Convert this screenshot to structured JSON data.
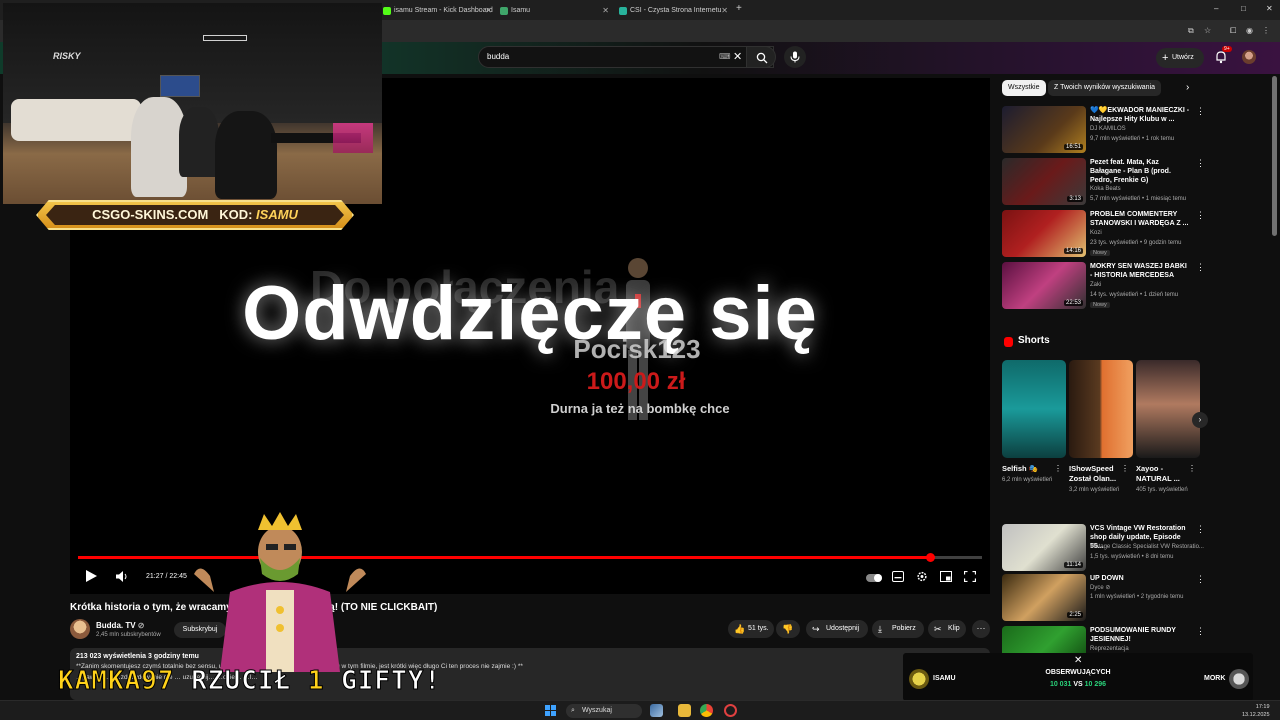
{
  "browser": {
    "tabs": [
      {
        "label": "isamu Stream - Kick Dashboard",
        "color": "#53fc18"
      },
      {
        "label": "Isamu",
        "color": "#3fa66a"
      },
      {
        "label": "CSI - Czysta Strona Internetu",
        "color": "#28b39c"
      }
    ],
    "new_tab": "+",
    "window_controls": [
      "–",
      "□",
      "✕"
    ]
  },
  "youtube": {
    "search": {
      "value": "budda"
    },
    "create_label": "Utwórz",
    "notif_count": "9+",
    "video": {
      "overlay_text": "Odwdzięczę się",
      "ghost_text": "Do połączenia",
      "donor_name": "Pocisk123",
      "donor_amount": "100,00 zł",
      "donor_message": "Durna ja też na bombkę chce",
      "time": "21:27 / 22:45",
      "progress": 0.943
    },
    "title": "Krótka historia o tym, że wracamy … pokaz Autoryzacją! (TO NIE CLICKBAIT)",
    "channel": {
      "name": "Budda. TV",
      "verified": "⊘",
      "subs": "2,45 mln subskrybentów",
      "subscribe": "Subskrybuj"
    },
    "actions": {
      "likes": "51 tys.",
      "share": "Udostępnij",
      "download": "Pobierz",
      "clip": "Klip",
      "more": "···"
    },
    "description": {
      "stats": "213 023 wyświetlenia  3 godziny temu",
      "line1": "**Zanim skomentujesz czymś totalnie bez sensu, upewnij się że nie poruszamy tego tematu w tym filmie, jest krótki więc długo Ci ten proces nie zajmie :) **",
      "line2": "…pawła si… …zdecydowanie nie … uzupełnij… …okie… …l…"
    },
    "chips": [
      "Wszystkie",
      "Z Twoich wyników wyszukiwania"
    ],
    "recommended": [
      {
        "title": "💙💛EKWADOR MANIECZKI - Najlepsze Hity Klubu w ...",
        "channel": "DJ KAMILOS",
        "meta": "9,7 mln wyświetleń • 1 rok temu",
        "duration": "16:51",
        "badge": ""
      },
      {
        "title": "Pezet feat. Mata, Kaz Bałagane - Plan B (prod. Pedro, Frenkie G)",
        "channel": "Koka Beats",
        "meta": "5,7 mln wyświetleń • 1 miesiąc temu",
        "duration": "3:13",
        "badge": ""
      },
      {
        "title": "PROBLEM COMMENTERY STANOWSKI I WARDĘGA Z ...",
        "channel": "Kozi",
        "meta": "23 tys. wyświetleń • 9 godzin temu",
        "duration": "14:16",
        "badge": "Nowy"
      },
      {
        "title": "MOKRY SEN WASZEJ BABKI - HISTORIA MERCEDESA",
        "channel": "Zaki",
        "meta": "14 tys. wyświetleń • 1 dzień temu",
        "duration": "22:53",
        "badge": "Nowy"
      }
    ],
    "shorts_heading": "Shorts",
    "shorts": [
      {
        "title": "Selfish 🎭",
        "meta": "6,2 mln wyświetleń"
      },
      {
        "title": "IShowSpeed Został Olan...",
        "meta": "3,2 mln wyświetleń"
      },
      {
        "title": "Xayoo - NATURAL ...",
        "meta": "405 tys. wyświetleń"
      }
    ],
    "recommended2": [
      {
        "title": "VCS Vintage VW Restoration shop daily update, Episode 55...",
        "channel": "Vintage Classic Specialist VW Restoratio...",
        "meta": "1,5 tys. wyświetleń • 8 dni temu",
        "duration": "11:14"
      },
      {
        "title": "UP DOWN",
        "channel": "Dyce ⊘",
        "meta": "1 mln wyświetleń • 2 tygodnie temu",
        "duration": "2:25"
      },
      {
        "title": "PODSUMOWANIE RUNDY JESIENNEJ!",
        "channel": "Reprezentacja",
        "meta": "",
        "duration": ""
      }
    ]
  },
  "stream_overlay": {
    "promo_site": "CSGO-SKINS.COM",
    "promo_code_label": "KOD:",
    "promo_code": "ISAMU",
    "gift_user": "KAMKA97",
    "gift_text": "RZUCIŁ",
    "gift_count": "1",
    "gift_word": "GIFTY!",
    "versus": {
      "title": "OBSERWUJĄCYCH",
      "left": "ISAMU",
      "right": "MORK",
      "left_score": "10 031",
      "vs": "VS",
      "right_score": "10 296",
      "close": "✕"
    }
  },
  "taskbar": {
    "search": "Wyszukaj",
    "time": "17:19",
    "date": "13.12.2025"
  },
  "colors": {
    "accent": "#ff0000",
    "gold": "#f2c44a",
    "neon_green": "#53fc18"
  }
}
